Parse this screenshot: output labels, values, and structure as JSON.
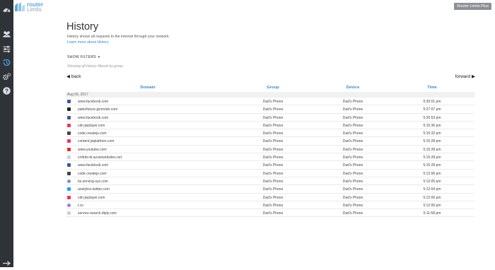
{
  "header": {
    "logo_line1": "router",
    "logo_line2": "Limits",
    "plan_badge": "Router Limits Plus"
  },
  "sidebar": {
    "items": [
      {
        "icon": "dashboard-icon"
      },
      {
        "icon": "users-icon"
      },
      {
        "icon": "sliders-icon"
      },
      {
        "icon": "history-icon",
        "active": true
      },
      {
        "icon": "gears-icon"
      },
      {
        "icon": "help-icon"
      }
    ],
    "bottom_icon": "logout-arrow-icon"
  },
  "page": {
    "title": "History",
    "description": "History shows all requests to the internet through your network.",
    "learn_more": "Learn more about History",
    "show_filters": "SHOW FILTERS",
    "filter_note": "Showing all history filtered by group",
    "back_label": "back",
    "forward_label": "forward"
  },
  "table": {
    "columns": [
      "Domain",
      "Group",
      "Device",
      "Time"
    ],
    "date_group": "Aug 06, 2017",
    "rows": [
      {
        "favicon": "facebook",
        "color": "#3b5998",
        "domain": "www.facebook.com",
        "group": "Dad's Phone",
        "device": "Dad's Phone",
        "time": "5:30:01 pm"
      },
      {
        "favicon": "gizmodo",
        "color": "#222222",
        "domain": "paleofuture.gizmodo.com",
        "group": "Dad's Phone",
        "device": "Dad's Phone",
        "time": "5:27:07 pm"
      },
      {
        "favicon": "facebook",
        "color": "#3b5998",
        "domain": "www.facebook.com",
        "group": "Dad's Phone",
        "device": "Dad's Phone",
        "time": "5:26:53 pm"
      },
      {
        "favicon": "jwplayer",
        "color": "#e8365d",
        "domain": "cdn.jwplayer.com",
        "group": "Dad's Phone",
        "device": "Dad's Phone",
        "time": "5:15:36 pm"
      },
      {
        "favicon": "createjs",
        "color": "#444444",
        "domain": "code.createjs.com",
        "group": "Dad's Phone",
        "device": "Dad's Phone",
        "time": "5:15:32 pm"
      },
      {
        "favicon": "jwplayer",
        "color": "#e8365d",
        "domain": "content.jwplatform.com",
        "group": "Dad's Phone",
        "device": "Dad's Phone",
        "time": "5:15:28 pm"
      },
      {
        "favicon": "youtube",
        "color": "#e52d27",
        "domain": "www.youtube.com",
        "group": "Dad's Phone",
        "device": "Dad's Phone",
        "time": "5:15:28 pm"
      },
      {
        "favicon": "generic",
        "color": "#c9d3e6",
        "domain": "cmbds-tk.azurewebsites.net",
        "group": "Dad's Phone",
        "device": "Dad's Phone",
        "time": "5:15:28 pm"
      },
      {
        "favicon": "facebook",
        "color": "#3b5998",
        "domain": "www.facebook.com",
        "group": "Dad's Phone",
        "device": "Dad's Phone",
        "time": "5:15:28 pm"
      },
      {
        "favicon": "createjs",
        "color": "#444444",
        "domain": "code.createjs.com",
        "group": "Dad's Phone",
        "device": "Dad's Phone",
        "time": "5:12:06 pm"
      },
      {
        "favicon": "serving-sys",
        "color": "#7a8fd6",
        "domain": "bs.serving-sys.com",
        "group": "Dad's Phone",
        "device": "Dad's Phone",
        "time": "5:12:05 pm"
      },
      {
        "favicon": "twitter",
        "color": "#1da1f2",
        "domain": "analytics.twitter.com",
        "group": "Dad's Phone",
        "device": "Dad's Phone",
        "time": "5:12:04 pm"
      },
      {
        "favicon": "jwplayer",
        "color": "#e8365d",
        "domain": "cdn.jwplayer.com",
        "group": "Dad's Phone",
        "device": "Dad's Phone",
        "time": "5:12:00 pm"
      },
      {
        "favicon": "tco",
        "color": "#9b7fd9",
        "domain": "t.co",
        "group": "Dad's Phone",
        "device": "Dad's Phone",
        "time": "5:12:00 pm"
      },
      {
        "favicon": "generic",
        "color": "#c9d3e6",
        "domain": "service-search.diply.com",
        "group": "Dad's Phone",
        "device": "Dad's Phone",
        "time": "5:11:58 pm"
      }
    ]
  }
}
